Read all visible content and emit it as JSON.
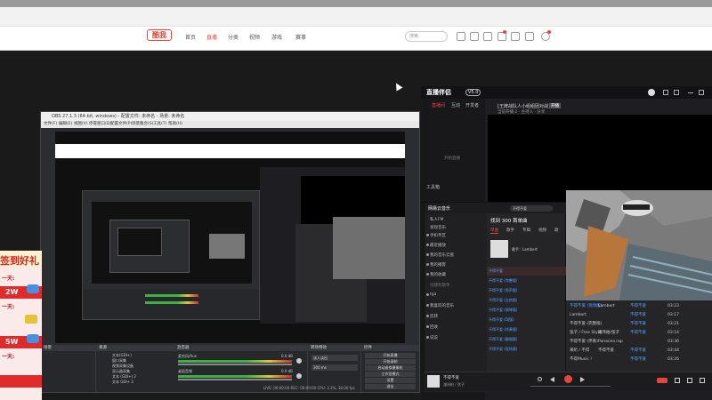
{
  "browser": {
    "logo": "酷我",
    "nav": [
      "首页",
      "直播",
      "分类",
      "视频",
      "游戏",
      "赛事"
    ],
    "active_nav": 1,
    "search_placeholder": "搜索"
  },
  "obs": {
    "title": "OBS 27.1.3 (64-bit, windows) - 配置文件: 未命名 - 场景: 未命名",
    "menu": [
      "文件(F)",
      "编辑(E)",
      "视图(V)",
      "停靠窗口(D)",
      "配置文件(P)",
      "场景集合(S)",
      "工具(T)",
      "帮助(H)"
    ],
    "docks": {
      "scenes": "场景",
      "sources": "来源",
      "mixer": "混音器",
      "transitions": "转场特效",
      "controls": "控件"
    },
    "sources_list": [
      "文本(GDI+)",
      "窗口采集",
      "视频采集设备",
      "显示器采集",
      "文本 (GDI+) 2",
      "文本 GDI+ 3"
    ],
    "mixer_items": [
      "麦克风/Aux",
      "桌面音频"
    ],
    "mixer_db": [
      "0.0 dB",
      "0.0 dB"
    ],
    "transition": "淡入淡出",
    "duration": "300 ms",
    "controls": [
      "开始直播",
      "开始录制",
      "启动虚拟摄像机",
      "工作室模式",
      "设置",
      "退出"
    ],
    "status": "LIVE: 00:00:00   REC: 00:00:00   CPU: 3.3%, 30.00 fps"
  },
  "kuwo": {
    "logo": "直播伴侣",
    "badge": "V5.0",
    "tabs": [
      "直播间",
      "互动",
      "开发者"
    ],
    "room_title": "[王牌战队人小组组团对战]",
    "room_tag": "开播",
    "room_sub": "当前开播·2 · 主持人 · 分享",
    "side_empty": "开始直播",
    "tool_label": "工具箱"
  },
  "music": {
    "logo": "网易云音乐",
    "search": "不得不爱",
    "header": "找到 300 首单曲",
    "tabs": [
      "单曲",
      "歌手",
      "专辑",
      "视频",
      "歌"
    ],
    "sidebar": [
      "私人FM",
      "发现音乐",
      "手机专区",
      "最近播放",
      "我的音乐云盘",
      "我的播客",
      "我的收藏",
      "创建的歌单",
      "tga",
      "我喜欢的音乐",
      "反转",
      "回收",
      "说说"
    ],
    "artist_hint": "歌手：Lambert",
    "now_playing_title": "不得不爱",
    "now_playing_artist": "潘玮柏 / 弦子",
    "rows": [
      "不得不爱",
      "不得不爱 (完整版)",
      "不得不爱 (男声版)",
      "不得不爱 (吉他版)",
      "不得不爱 (钢琴版)",
      "不得不爱 (DJ版)",
      "不得不爱 (伴奏版)",
      "不得不爱 (翻唱版)",
      "不得不爱 (现场版)"
    ]
  },
  "tracklist": [
    {
      "title": "不得不爱 (现场版)",
      "artist": "Lambert",
      "album": "不得不爱",
      "time": "03:23"
    },
    {
      "title": "Lambert",
      "artist": "",
      "album": "不得不爱",
      "time": "03:17"
    },
    {
      "title": "不得不爱 (完整版)",
      "artist": "",
      "album": "不得不爱",
      "time": "03:21"
    },
    {
      "title": "弦子 / Free Style",
      "artist": "潘玮柏/弦子",
      "album": "不得不爱",
      "time": "03:14"
    },
    {
      "title": "不得不爱 (伴奏)",
      "artist": "Panacea rap",
      "album": "",
      "time": "03:36"
    },
    {
      "title": "来听 / 不得",
      "artist": "不得不爱",
      "album": "不得不爱",
      "time": "03:44"
    },
    {
      "title": "不得Music !",
      "artist": "",
      "album": "不得不爱",
      "time": "03:26"
    }
  ],
  "promo": {
    "headline": "签到好礼",
    "day_label": "一天:",
    "prizes": [
      "2W",
      "5W"
    ]
  },
  "colors": {
    "accent_red": "#e6453c",
    "kuwo_bg": "#1e1e22",
    "obs_bg": "#2b2d31",
    "live_red": "#e02b2b"
  }
}
